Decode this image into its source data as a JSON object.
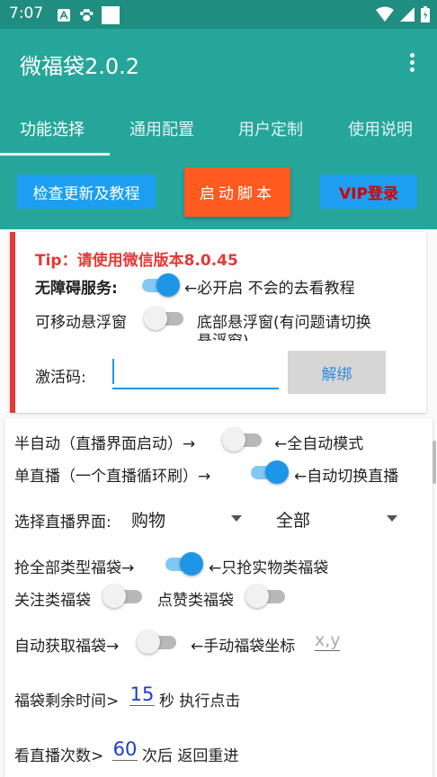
{
  "status": {
    "time": "7:07"
  },
  "app": {
    "title": "微福袋2.0.2"
  },
  "tabs": [
    {
      "label": "功能选择"
    },
    {
      "label": "通用配置"
    },
    {
      "label": "用户定制"
    },
    {
      "label": "使用说明"
    }
  ],
  "actions": {
    "check_update": "检查更新及教程",
    "start": "启动脚本",
    "vip": "VIP登录"
  },
  "card1": {
    "tip": "Tip：请使用微信版本8.0.45",
    "accessibility_label": "无障碍服务:",
    "accessibility_on": true,
    "accessibility_hint": "←必开启 不会的去看教程",
    "movable_float_label": "可移动悬浮窗",
    "movable_float_on": false,
    "bottom_float_line1": "底部悬浮窗(有问题请切换",
    "bottom_float_line2": "悬浮窗)",
    "activation_label": "激活码:",
    "activation_value": "",
    "unbind": "解绑"
  },
  "card2": {
    "semi_auto": "半自动（直播界面启动）→",
    "semi_auto_on": false,
    "full_auto": "←全自动模式",
    "single_live": "单直播（一个直播循环刷）→",
    "single_live_on": true,
    "auto_switch": "←自动切换直播",
    "select_live_label": "选择直播界面:",
    "select_live_value": "购物",
    "select_scope_value": "全部",
    "grab_all": "抢全部类型福袋→",
    "grab_all_on": true,
    "grab_physical": "←只抢实物类福袋",
    "follow_bag": "关注类福袋",
    "follow_bag_on": false,
    "like_bag": "点赞类福袋",
    "like_bag_on": false,
    "auto_get": "自动获取福袋→",
    "auto_get_on": false,
    "manual_coord": "←手动福袋坐标",
    "coord_placeholder": "x,y",
    "remaining_label": "福袋剩余时间>",
    "remaining_value": "15",
    "remaining_suffix": "秒 执行点击",
    "watch_label": "看直播次数>",
    "watch_value": "60",
    "watch_suffix": "次后 返回重进"
  }
}
